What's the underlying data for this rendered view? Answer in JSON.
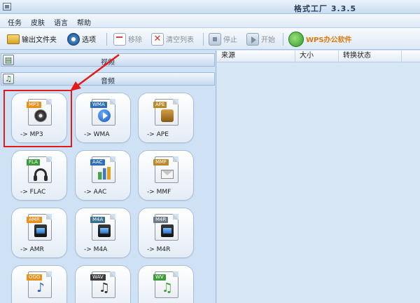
{
  "window": {
    "title": "格式工厂  3.3.5"
  },
  "menu": {
    "items": [
      "任务",
      "皮肤",
      "语言",
      "帮助"
    ]
  },
  "toolbar": {
    "output_folder": "输出文件夹",
    "options": "选项",
    "remove": "移除",
    "clear_list": "清空列表",
    "stop": "停止",
    "start": "开始",
    "wps": "WPS办公软件"
  },
  "categories": {
    "video": "视频",
    "audio": "音频"
  },
  "formats": [
    {
      "badge": "MP3",
      "label": "-> MP3",
      "badge_color": "#e8911c",
      "icon": "disc-icon"
    },
    {
      "badge": "WMA",
      "label": "-> WMA",
      "badge_color": "#2f6fb7",
      "icon": "play-icon"
    },
    {
      "badge": "APE",
      "label": "-> APE",
      "badge_color": "#b98a2c",
      "icon": "speaker-icon"
    },
    {
      "badge": "FLA",
      "label": "-> FLAC",
      "badge_color": "#3e9b3a",
      "icon": "headphone-icon"
    },
    {
      "badge": "AAC",
      "label": "-> AAC",
      "badge_color": "#2f6fb7",
      "icon": "chart-icon"
    },
    {
      "badge": "MMF",
      "label": "-> MMF",
      "badge_color": "#b98a2c",
      "icon": "envelope-icon"
    },
    {
      "badge": "AMR",
      "label": "-> AMR",
      "badge_color": "#e8911c",
      "icon": "video-icon"
    },
    {
      "badge": "M4A",
      "label": "-> M4A",
      "badge_color": "#3a6e8f",
      "icon": "video-icon"
    },
    {
      "badge": "M4R",
      "label": "-> M4R",
      "badge_color": "#6e7a86",
      "icon": "video-icon"
    },
    {
      "badge": "OGG",
      "label": "",
      "badge_color": "#e8911c",
      "icon": "note-icon"
    },
    {
      "badge": "WAV",
      "label": "",
      "badge_color": "#3a3a3a",
      "icon": "note-icon"
    },
    {
      "badge": "WV",
      "label": "",
      "badge_color": "#3e9b3a",
      "icon": "note-icon"
    }
  ],
  "list": {
    "columns": [
      "来源",
      "大小",
      "转换状态"
    ]
  },
  "colors": {
    "highlight": "#e41a1a",
    "accent": "#2f6fb7"
  }
}
